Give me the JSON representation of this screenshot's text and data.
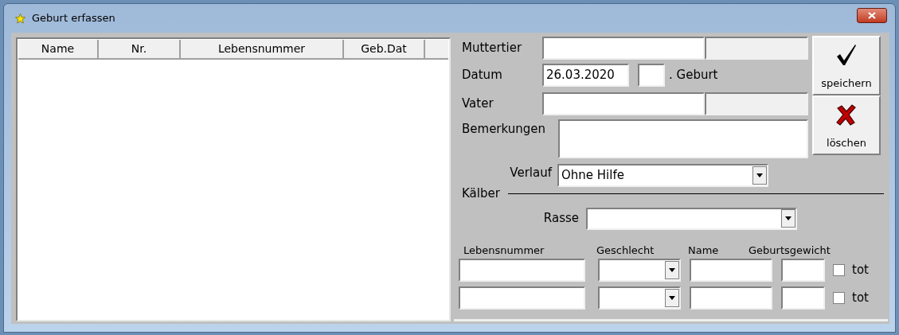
{
  "window": {
    "title": "Geburt erfassen"
  },
  "list": {
    "columns": [
      "Name",
      "Nr.",
      "Lebensnummer",
      "Geb.Dat"
    ]
  },
  "form": {
    "muttertier": {
      "label": "Muttertier"
    },
    "datum": {
      "label": "Datum",
      "value": "26.03.2020",
      "suffix": ". Geburt"
    },
    "vater": {
      "label": "Vater"
    },
    "bemerkungen": {
      "label": "Bemerkungen"
    },
    "verlauf": {
      "label": "Verlauf",
      "value": "Ohne Hilfe"
    }
  },
  "buttons": [
    {
      "kind": "save",
      "label": "speichern"
    },
    {
      "kind": "delete",
      "label": "löschen"
    }
  ],
  "kaelber": {
    "heading": "Kälber",
    "rasse": {
      "label": "Rasse"
    },
    "columns": [
      "Lebensnummer",
      "Geschlecht",
      "Name",
      "Geburtsgewicht"
    ],
    "rows": [
      {
        "tot_label": "tot",
        "checked": false
      },
      {
        "tot_label": "tot",
        "checked": false
      }
    ]
  }
}
